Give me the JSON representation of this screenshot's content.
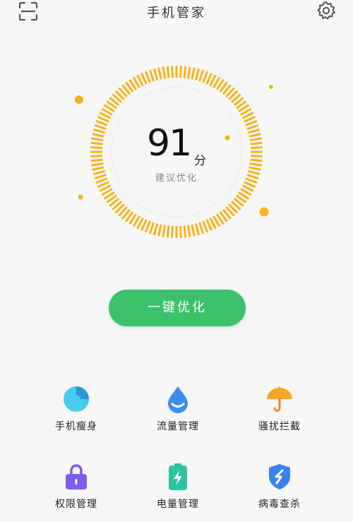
{
  "header": {
    "title": "手机管家",
    "scan_icon": "scan-icon",
    "settings_icon": "gear-icon"
  },
  "score": {
    "value": "91",
    "unit": "分",
    "hint": "建议优化"
  },
  "action": {
    "optimize_label": "一键优化"
  },
  "tools": [
    {
      "label": "手机瘦身",
      "icon": "pie-chart-icon",
      "color": "#3cc8e8"
    },
    {
      "label": "流量管理",
      "icon": "droplet-icon",
      "color": "#3b8cf0"
    },
    {
      "label": "骚扰拦截",
      "icon": "umbrella-icon",
      "color": "#f6a623"
    },
    {
      "label": "权限管理",
      "icon": "lock-icon",
      "color": "#7d5cf0"
    },
    {
      "label": "电量管理",
      "icon": "battery-icon",
      "color": "#2ec4a0"
    },
    {
      "label": "病毒查杀",
      "icon": "shield-icon",
      "color": "#3b82f0"
    }
  ],
  "colors": {
    "accent_orange": "#f6b21b",
    "action_green": "#3cc16b",
    "background": "#f7f7f7"
  }
}
